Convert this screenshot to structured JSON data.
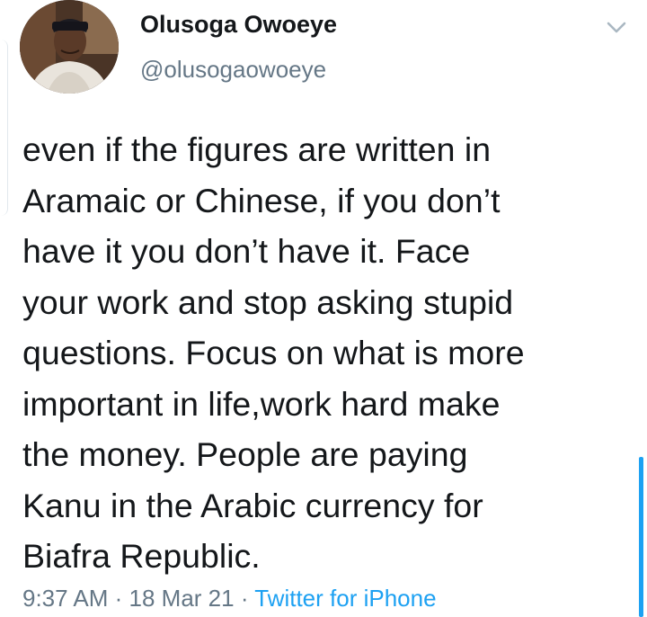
{
  "tweet": {
    "display_name": "Olusoga Owoeye",
    "handle": "@olusogaowoeye",
    "text": "even if the figures are written in\nAramaic or Chinese, if you don’t\nhave it you don’t have it. Face\nyour work and stop asking stupid\nquestions.  Focus on what is more\nimportant in life,work hard make\nthe money. People are paying\nKanu in the Arabic currency for\nBiafra Republic.",
    "time": "9:37 AM",
    "separator": " · ",
    "date": "18 Mar 21",
    "source": "Twitter for iPhone"
  },
  "icons": {
    "menu": "chevron-down-icon"
  },
  "colors": {
    "text": "#14171a",
    "secondary": "#657786",
    "link": "#1da1f2"
  }
}
